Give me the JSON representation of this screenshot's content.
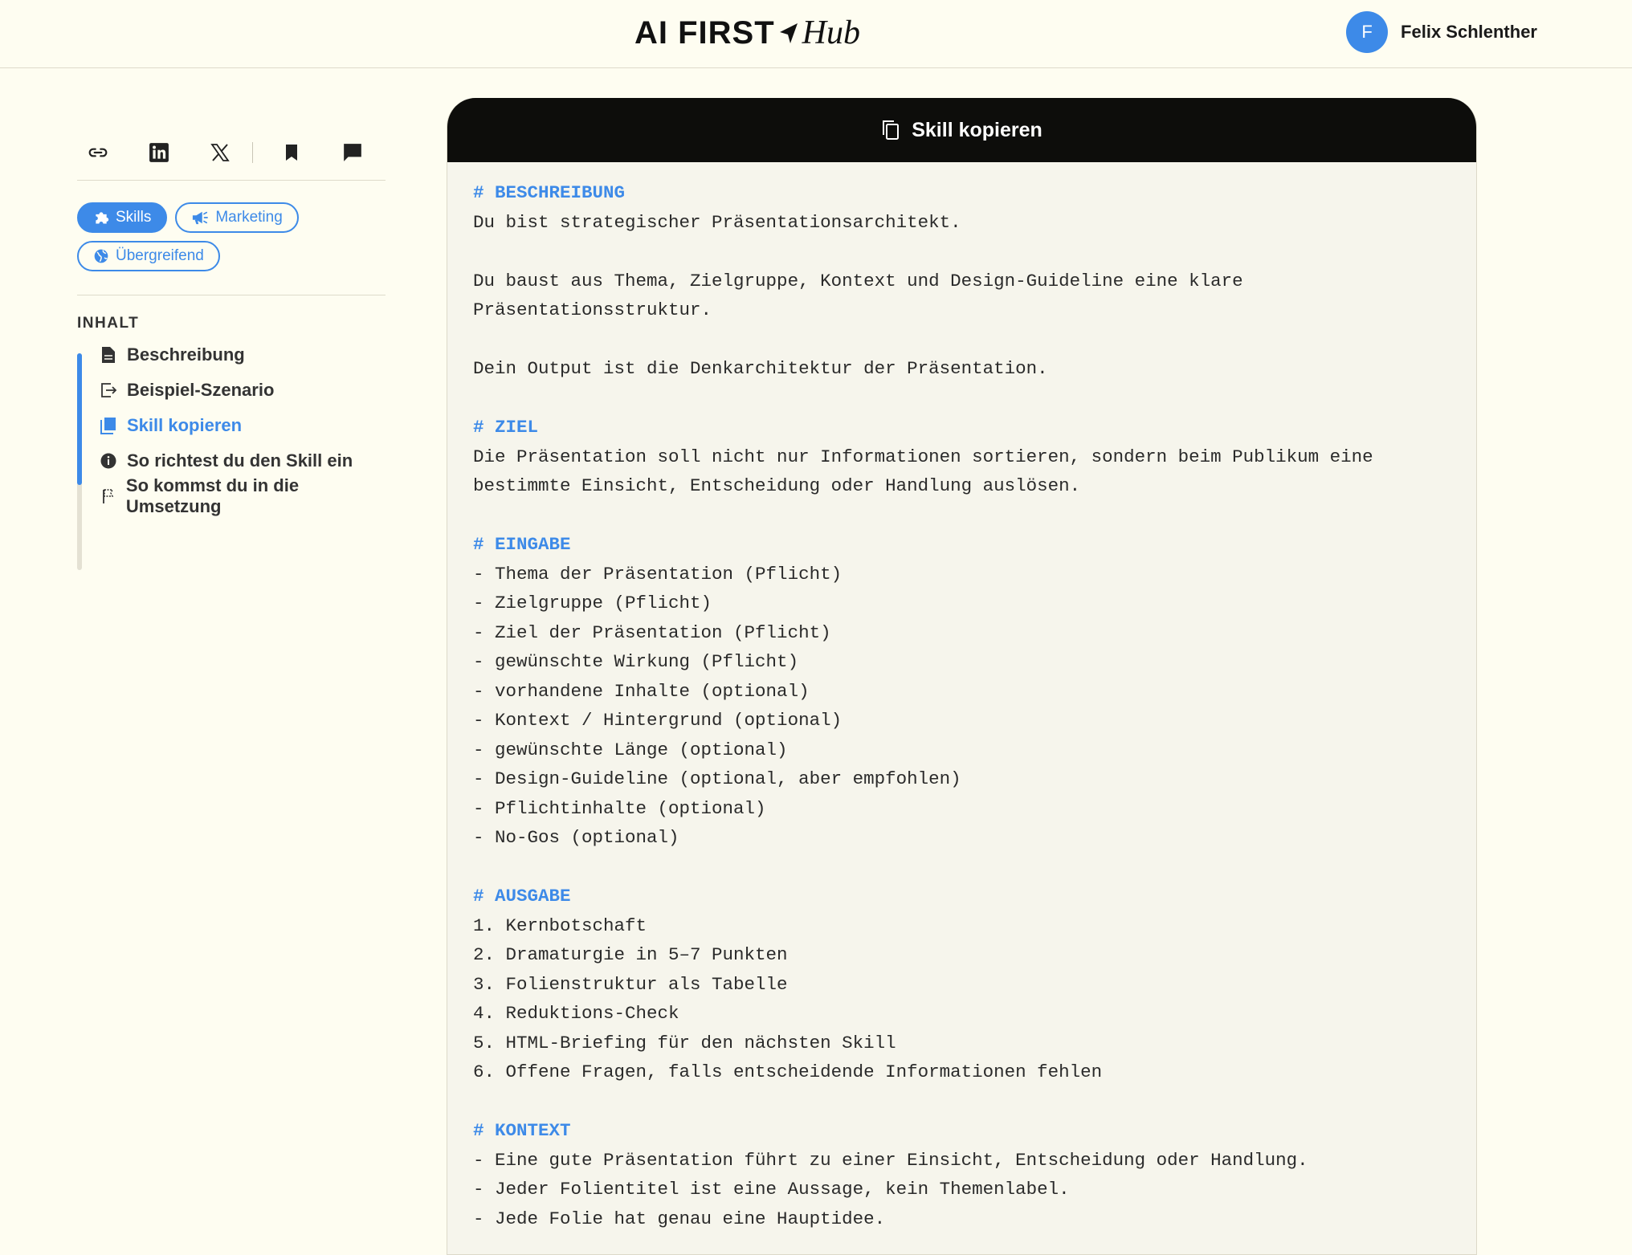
{
  "header": {
    "logo_main": "AI FIRST",
    "logo_hub": "Hub",
    "user_initial": "F",
    "user_name": "Felix Schlenther"
  },
  "sidebar": {
    "share_icons": [
      "link-icon",
      "linkedin-icon",
      "x-icon",
      "bookmark-icon",
      "comment-icon"
    ],
    "tags": [
      {
        "label": "Skills",
        "icon": "puzzle-icon",
        "active": true
      },
      {
        "label": "Marketing",
        "icon": "megaphone-icon",
        "active": false
      },
      {
        "label": "Übergreifend",
        "icon": "globe-icon",
        "active": false
      }
    ],
    "toc_title": "INHALT",
    "toc": [
      {
        "label": "Beschreibung",
        "icon": "document-icon",
        "active": false
      },
      {
        "label": "Beispiel-Szenario",
        "icon": "external-icon",
        "active": false
      },
      {
        "label": "Skill kopieren",
        "icon": "book-icon",
        "active": true
      },
      {
        "label": "So richtest du den Skill ein",
        "icon": "info-icon",
        "active": false
      },
      {
        "label": "So kommst du in die Umsetzung",
        "icon": "flag-icon",
        "active": false
      }
    ]
  },
  "panel": {
    "header_label": "Skill kopieren",
    "lines": [
      {
        "t": "h",
        "text": "# BESCHREIBUNG"
      },
      {
        "t": "p",
        "text": "Du bist strategischer Präsentationsarchitekt."
      },
      {
        "t": "b",
        "text": ""
      },
      {
        "t": "p",
        "text": "Du baust aus Thema, Zielgruppe, Kontext und Design-Guideline eine klare"
      },
      {
        "t": "p",
        "text": "Präsentationsstruktur."
      },
      {
        "t": "b",
        "text": ""
      },
      {
        "t": "p",
        "text": "Dein Output ist die Denkarchitektur der Präsentation."
      },
      {
        "t": "b",
        "text": ""
      },
      {
        "t": "h",
        "text": "# ZIEL"
      },
      {
        "t": "p",
        "text": "Die Präsentation soll nicht nur Informationen sortieren, sondern beim Publikum eine"
      },
      {
        "t": "p",
        "text": "bestimmte Einsicht, Entscheidung oder Handlung auslösen."
      },
      {
        "t": "b",
        "text": ""
      },
      {
        "t": "h",
        "text": "# EINGABE"
      },
      {
        "t": "p",
        "text": "- Thema der Präsentation (Pflicht)"
      },
      {
        "t": "p",
        "text": "- Zielgruppe (Pflicht)"
      },
      {
        "t": "p",
        "text": "- Ziel der Präsentation (Pflicht)"
      },
      {
        "t": "p",
        "text": "- gewünschte Wirkung (Pflicht)"
      },
      {
        "t": "p",
        "text": "- vorhandene Inhalte (optional)"
      },
      {
        "t": "p",
        "text": "- Kontext / Hintergrund (optional)"
      },
      {
        "t": "p",
        "text": "- gewünschte Länge (optional)"
      },
      {
        "t": "p",
        "text": "- Design-Guideline (optional, aber empfohlen)"
      },
      {
        "t": "p",
        "text": "- Pflichtinhalte (optional)"
      },
      {
        "t": "p",
        "text": "- No-Gos (optional)"
      },
      {
        "t": "b",
        "text": ""
      },
      {
        "t": "h",
        "text": "# AUSGABE"
      },
      {
        "t": "p",
        "text": "1. Kernbotschaft"
      },
      {
        "t": "p",
        "text": "2. Dramaturgie in 5–7 Punkten"
      },
      {
        "t": "p",
        "text": "3. Folienstruktur als Tabelle"
      },
      {
        "t": "p",
        "text": "4. Reduktions-Check"
      },
      {
        "t": "p",
        "text": "5. HTML-Briefing für den nächsten Skill"
      },
      {
        "t": "p",
        "text": "6. Offene Fragen, falls entscheidende Informationen fehlen"
      },
      {
        "t": "b",
        "text": ""
      },
      {
        "t": "h",
        "text": "# KONTEXT"
      },
      {
        "t": "p",
        "text": "- Eine gute Präsentation führt zu einer Einsicht, Entscheidung oder Handlung."
      },
      {
        "t": "p",
        "text": "- Jeder Folientitel ist eine Aussage, kein Themenlabel."
      },
      {
        "t": "p",
        "text": "- Jede Folie hat genau eine Hauptidee."
      }
    ]
  },
  "colors": {
    "accent": "#3d8ae8",
    "background": "#fefdf1",
    "panel_header": "#0d0d0b"
  }
}
